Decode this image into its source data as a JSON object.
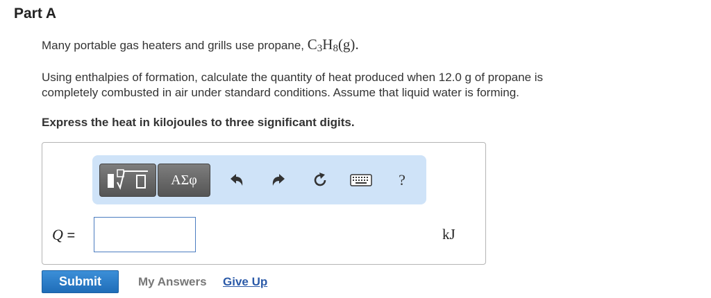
{
  "part": {
    "title": "Part A"
  },
  "intro": {
    "text": "Many portable gas heaters and grills use propane,",
    "formula": {
      "c": "C",
      "c_sub": "3",
      "h": "H",
      "h_sub": "8",
      "phase": "(g)",
      "end": "."
    }
  },
  "question": {
    "line1": "Using enthalpies of formation, calculate the quantity of heat produced when 12.0  g of propane is",
    "line2": "completely combusted in air under standard conditions. Assume that liquid water is forming."
  },
  "instruction": "Express the heat in kilojoules to three significant digits.",
  "toolbar": {
    "symbols_label": "ΑΣφ",
    "help_label": "?"
  },
  "answer": {
    "variable": "Q",
    "equals": "=",
    "value": "",
    "unit": "kJ"
  },
  "actions": {
    "submit_label": "Submit",
    "my_answers_label": "My Answers",
    "give_up_label": "Give Up"
  },
  "colors": {
    "toolbar_bg": "#cfe3f8",
    "submit_bg": "#2a7cc7",
    "link": "#2b5aa8"
  }
}
